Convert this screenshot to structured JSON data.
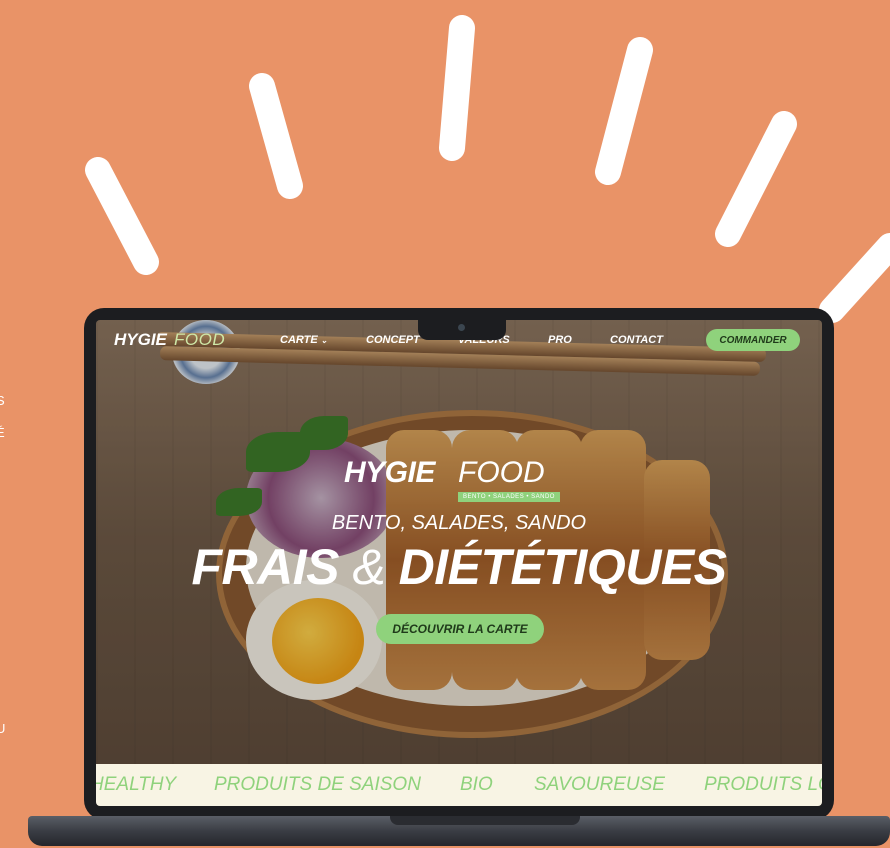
{
  "colors": {
    "background": "#E99367",
    "accent_green": "#8fd27c",
    "ticker_bg": "#f8f4e4"
  },
  "left_edge_text": [
    "S",
    "É",
    "U"
  ],
  "nav": {
    "logo_bold": "HYGIE",
    "logo_light": "FOOD",
    "items": [
      {
        "label": "CARTE",
        "icon": "chevron-down-icon"
      },
      {
        "label": "CONCEPT"
      },
      {
        "label": "VALEURS"
      },
      {
        "label": "PRO"
      },
      {
        "label": "CONTACT"
      }
    ],
    "cta": "COMMANDER"
  },
  "hero": {
    "logo_bold": "HYGIE",
    "logo_light": "FOOD",
    "logo_tagline": "BENTO • SALADES • SANDO",
    "subtitle": "BENTO, SALADES, SANDO",
    "title_part1": "FRAIS",
    "title_amp": "&",
    "title_part2": "DIÉTÉTIQUES",
    "cta": "DÉCOUVRIR LA CARTE"
  },
  "ticker": [
    "HEALTHY",
    "PRODUITS DE SAISON",
    "BIO",
    "SAVOUREUSE",
    "PRODUITS LO"
  ]
}
